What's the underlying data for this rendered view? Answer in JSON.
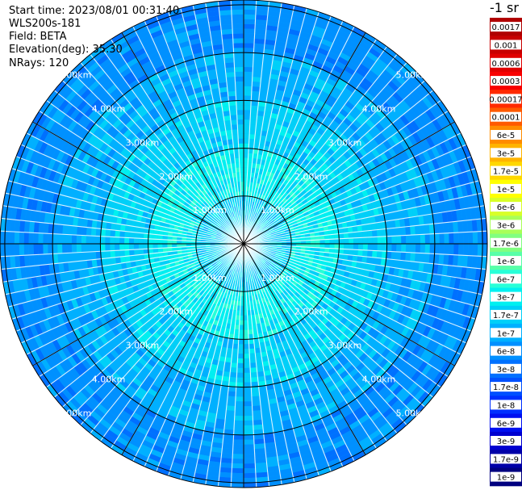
{
  "header": {
    "start_time": "Start time: 2023/08/01 00:31:40",
    "device": "WLS200s-181",
    "field": "Field: BETA",
    "elevation": "Elevation(deg): 35.30",
    "nrays": "NRays: 120"
  },
  "colorbar": {
    "unit_label": "-1 sr",
    "labels": [
      "0.0017",
      "0.001",
      "0.0006",
      "0.0003",
      "0.00017",
      "0.0001",
      "6e-5",
      "3e-5",
      "1.7e-5",
      "1e-5",
      "6e-6",
      "3e-6",
      "1.7e-6",
      "1e-6",
      "6e-7",
      "3e-7",
      "1.7e-7",
      "1e-7",
      "6e-8",
      "3e-8",
      "1.7e-8",
      "1e-8",
      "6e-9",
      "3e-9",
      "1.7e-9",
      "1e-9"
    ],
    "colors": [
      "#b00000",
      "#c80000",
      "#e00000",
      "#f80000",
      "#ff2a00",
      "#ff5a00",
      "#ff8c00",
      "#ffb400",
      "#ffd800",
      "#ffff00",
      "#d8ff28",
      "#a8ff58",
      "#80ff80",
      "#58ffa8",
      "#28ffd8",
      "#00f0f0",
      "#00d0f8",
      "#00b0ff",
      "#0090ff",
      "#0070ff",
      "#0050ff",
      "#0030ff",
      "#0010f0",
      "#0000d0",
      "#0000a8",
      "#000080"
    ]
  },
  "chart_data": {
    "type": "heatmap",
    "projection": "polar (PPI scan)",
    "field": "BETA",
    "nrays": 120,
    "range_rings_km": [
      1.0,
      2.0,
      3.0,
      4.0,
      5.0
    ],
    "ring_labels": [
      "1.00km",
      "2.00km",
      "3.00km",
      "4.00km",
      "5.00km"
    ],
    "max_range_km": 5.1,
    "spoke_angles_deg": [
      0,
      30,
      60,
      90,
      120,
      150,
      180,
      210,
      240,
      270,
      300,
      330
    ],
    "label_angles_deg": [
      45,
      135,
      225,
      315
    ],
    "radial_profile": [
      {
        "range_km": 0.5,
        "dominant_value": "1.7e-7"
      },
      {
        "range_km": 1.5,
        "dominant_value": "3e-7"
      },
      {
        "range_km": 2.5,
        "dominant_value": "1.7e-7"
      },
      {
        "range_km": 3.5,
        "dominant_value": "1e-7"
      },
      {
        "range_km": 4.5,
        "dominant_value": "6e-8"
      }
    ],
    "grid": true
  }
}
